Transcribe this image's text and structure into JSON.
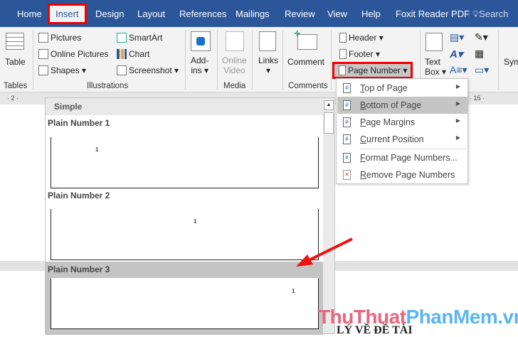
{
  "tabs": [
    "Home",
    "Insert",
    "Design",
    "Layout",
    "References",
    "Mailings",
    "Review",
    "View",
    "Help",
    "Foxit Reader PDF"
  ],
  "search_label": "Search",
  "ribbon": {
    "table": "Table",
    "pictures": "Pictures",
    "online_pictures": "Online Pictures",
    "shapes": "Shapes",
    "smartart": "SmartArt",
    "chart": "Chart",
    "screenshot": "Screenshot",
    "addins": "Add-",
    "addins2": "ins",
    "online_video": "Online",
    "online_video2": "Video",
    "links": "Links",
    "comment": "Comment",
    "header": "Header",
    "footer": "Footer",
    "page_number": "Page Number",
    "text_box": "Text",
    "text_box2": "Box",
    "symbols": "Sym",
    "groups": {
      "tables": "Tables",
      "illustrations": "Illustrations",
      "media": "Media",
      "comments": "Comments"
    }
  },
  "ruler": {
    "left": "· 2 ·",
    "right": "· 15 ·"
  },
  "gallery": {
    "section": "Simple",
    "items": [
      {
        "label": "Plain Number 1",
        "num": "1"
      },
      {
        "label": "Plain Number 2",
        "num": "1"
      },
      {
        "label": "Plain Number 3",
        "num": "1"
      }
    ]
  },
  "menu": [
    {
      "pre": "",
      "u": "T",
      "rest": "op of Page"
    },
    {
      "pre": "",
      "u": "B",
      "rest": "ottom of Page"
    },
    {
      "pre": "",
      "u": "P",
      "rest": "age Margins"
    },
    {
      "pre": "",
      "u": "C",
      "rest": "urrent Position"
    },
    {
      "pre": "",
      "u": "F",
      "rest": "ormat Page Numbers..."
    },
    {
      "pre": "",
      "u": "R",
      "rest": "emove Page Numbers"
    }
  ],
  "doc_text": "LÝ VỀ ĐỀ TÀI",
  "watermark": {
    "a": "ThuThuat",
    "b": "PhanMem.vn"
  }
}
